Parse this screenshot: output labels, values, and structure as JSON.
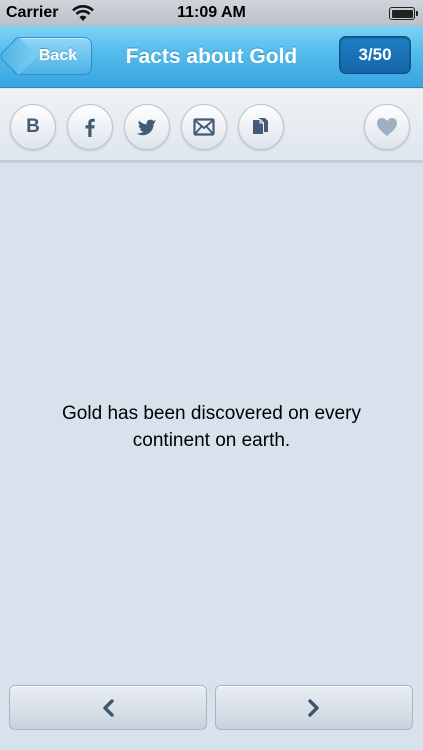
{
  "status_bar": {
    "carrier": "Carrier",
    "time": "11:09 AM"
  },
  "nav": {
    "back_label": "Back",
    "title": "Facts about Gold",
    "counter": "3/50"
  },
  "toolbar": {
    "buttons": [
      {
        "icon": "b-letter-icon",
        "label": "B"
      },
      {
        "icon": "facebook-icon"
      },
      {
        "icon": "twitter-icon"
      },
      {
        "icon": "mail-icon"
      },
      {
        "icon": "copy-icon"
      },
      {
        "icon": "heart-icon"
      }
    ]
  },
  "content": {
    "fact_text": "Gold has been discovered on every continent on earth."
  },
  "colors": {
    "nav_accent": "#37a5e0",
    "counter_bg": "#1466a8",
    "icon_color": "#445b74",
    "background": "#d8e2ec"
  }
}
